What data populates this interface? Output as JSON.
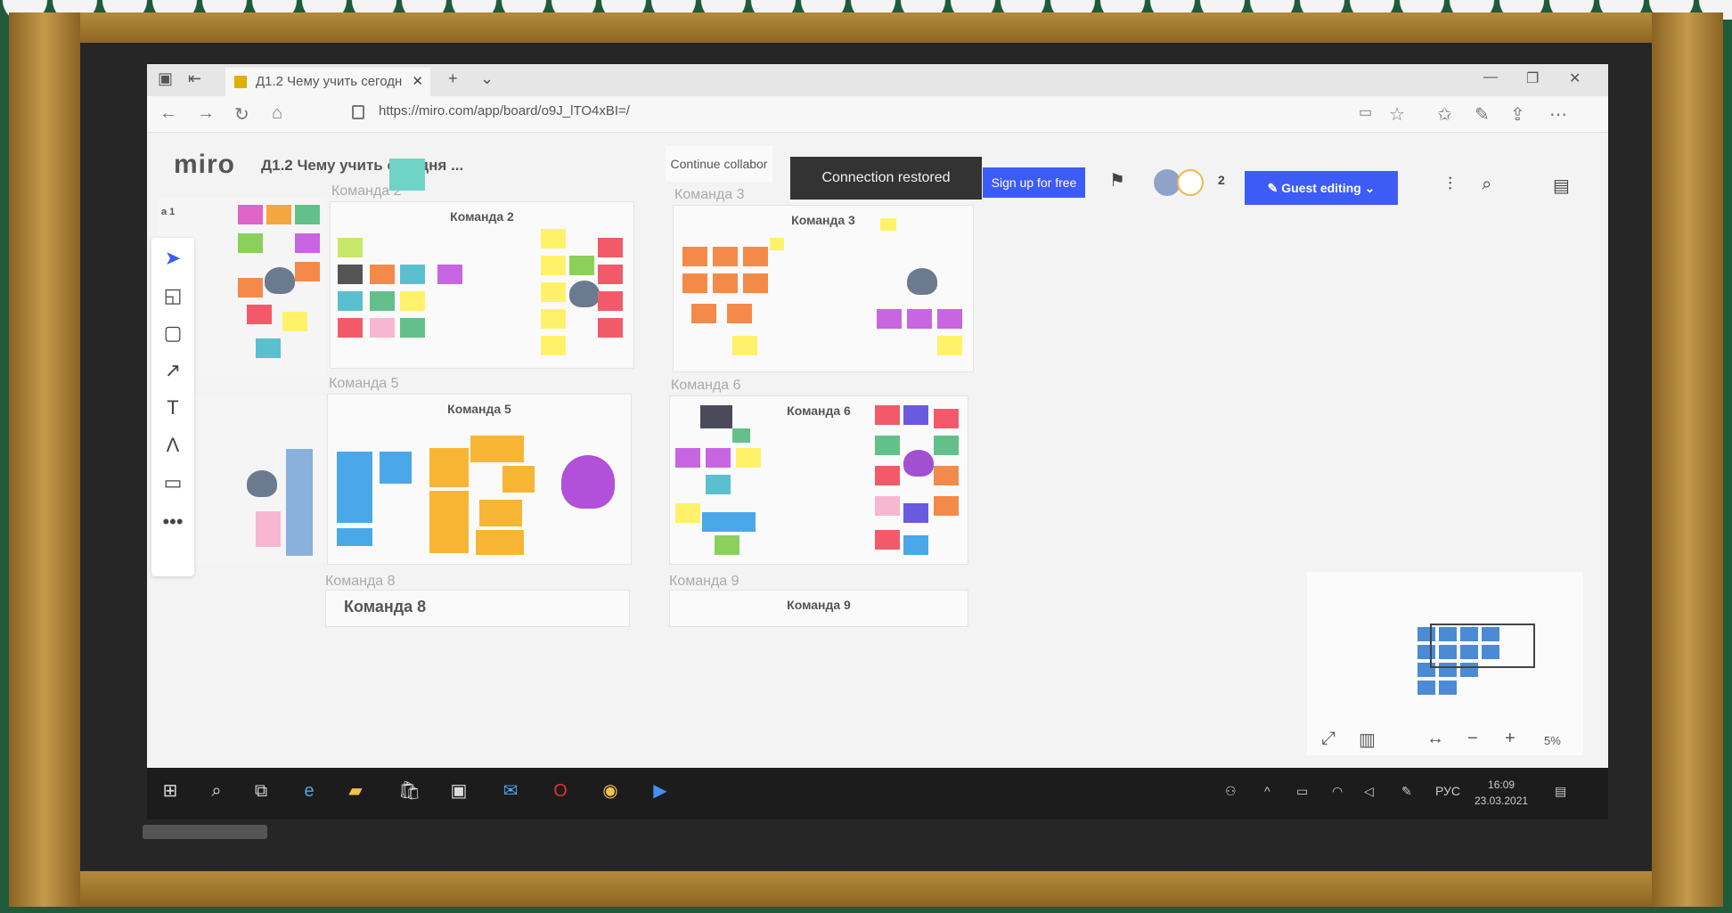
{
  "browser": {
    "tab_title": "Д1.2 Чему учить сегодн",
    "tab_close": "✕",
    "new_tab": "+",
    "url": "https://miro.com/app/board/o9J_lTO4xBI=/"
  },
  "miro": {
    "logo": "miro",
    "board_title": "Д1.2 Чему учить сегодня ...",
    "continue_text": "Continue collabor",
    "toast": "Connection restored",
    "signup": "Sign up for free",
    "participants_count": "2",
    "guest_editing": "Guest editing"
  },
  "board": {
    "frames": [
      {
        "label": "Команда 2",
        "title": "Команда 2"
      },
      {
        "label": "Команда 3",
        "title": "Команда 3"
      },
      {
        "label": "Команда 5",
        "title": "Команда 5"
      },
      {
        "label": "Команда 6",
        "title": "Команда 6"
      },
      {
        "label": "Команда 8",
        "title": "Команда 8"
      },
      {
        "label": "Команда 9",
        "title": "Команда 9"
      }
    ],
    "left_frame_title": "а 1"
  },
  "zoom": {
    "level": "5%"
  },
  "taskbar": {
    "lang": "РУС",
    "time": "16:09",
    "date": "23.03.2021"
  },
  "colors": {
    "accent": "#3d5cf5",
    "toast_bg": "#333333"
  }
}
